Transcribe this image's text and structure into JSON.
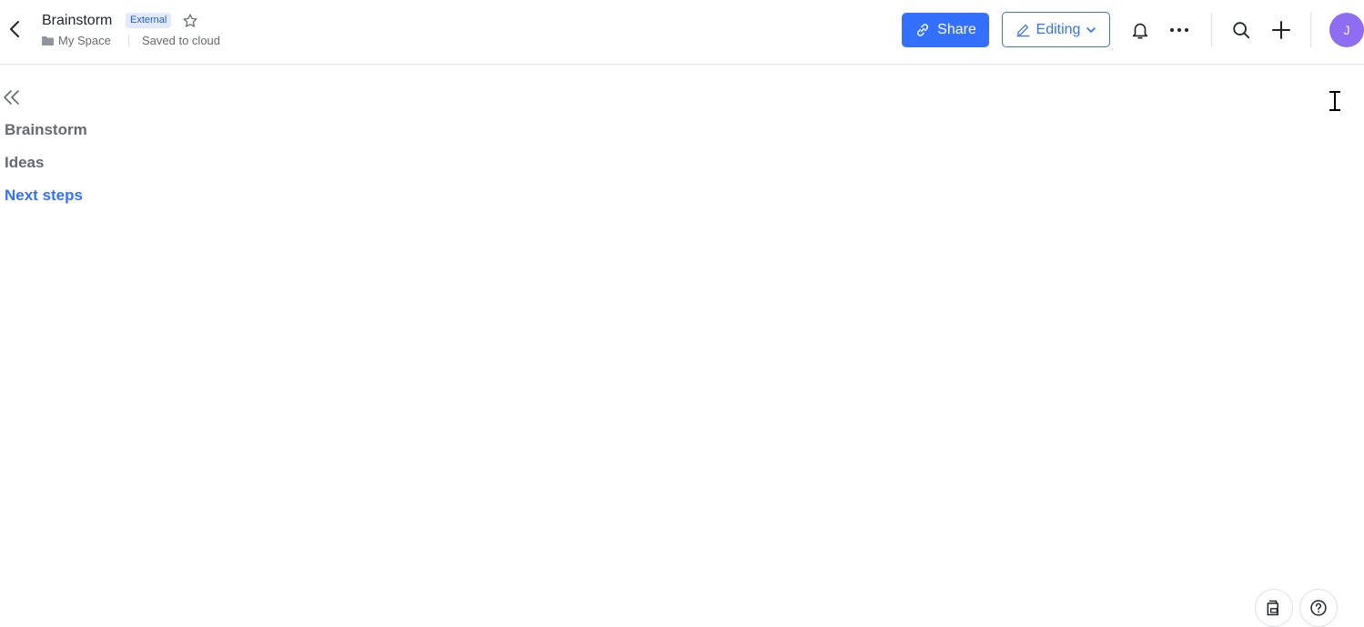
{
  "header": {
    "back_icon": "chevron-left-icon",
    "title": "Brainstorm",
    "badge": "External",
    "star_icon": "star-outline-icon",
    "folder_icon": "folder-icon",
    "location": "My Space",
    "save_status": "Saved to cloud"
  },
  "toolbar": {
    "share_label": "Share",
    "share_icon": "link-icon",
    "editing_label": "Editing",
    "editing_icon": "pencil-icon",
    "notifications_icon": "bell-icon",
    "more_icon": "more-horizontal-icon",
    "search_icon": "search-icon",
    "create_icon": "plus-icon",
    "avatar_initial": "J"
  },
  "outline": {
    "collapse_icon": "double-chevron-left-icon",
    "items": [
      {
        "label": "Brainstorm",
        "active": false
      },
      {
        "label": "Ideas",
        "active": false
      },
      {
        "label": "Next steps",
        "active": true
      }
    ]
  },
  "floating": {
    "doc_info_icon": "document-info-icon",
    "help_icon": "help-circle-icon"
  },
  "colors": {
    "accent": "#3370ff",
    "badge_bg": "#e1eaff",
    "badge_text": "#245bdb",
    "muted_text": "#646a73",
    "avatar_bg": "#8f6df0",
    "divider": "#dee0e3"
  }
}
